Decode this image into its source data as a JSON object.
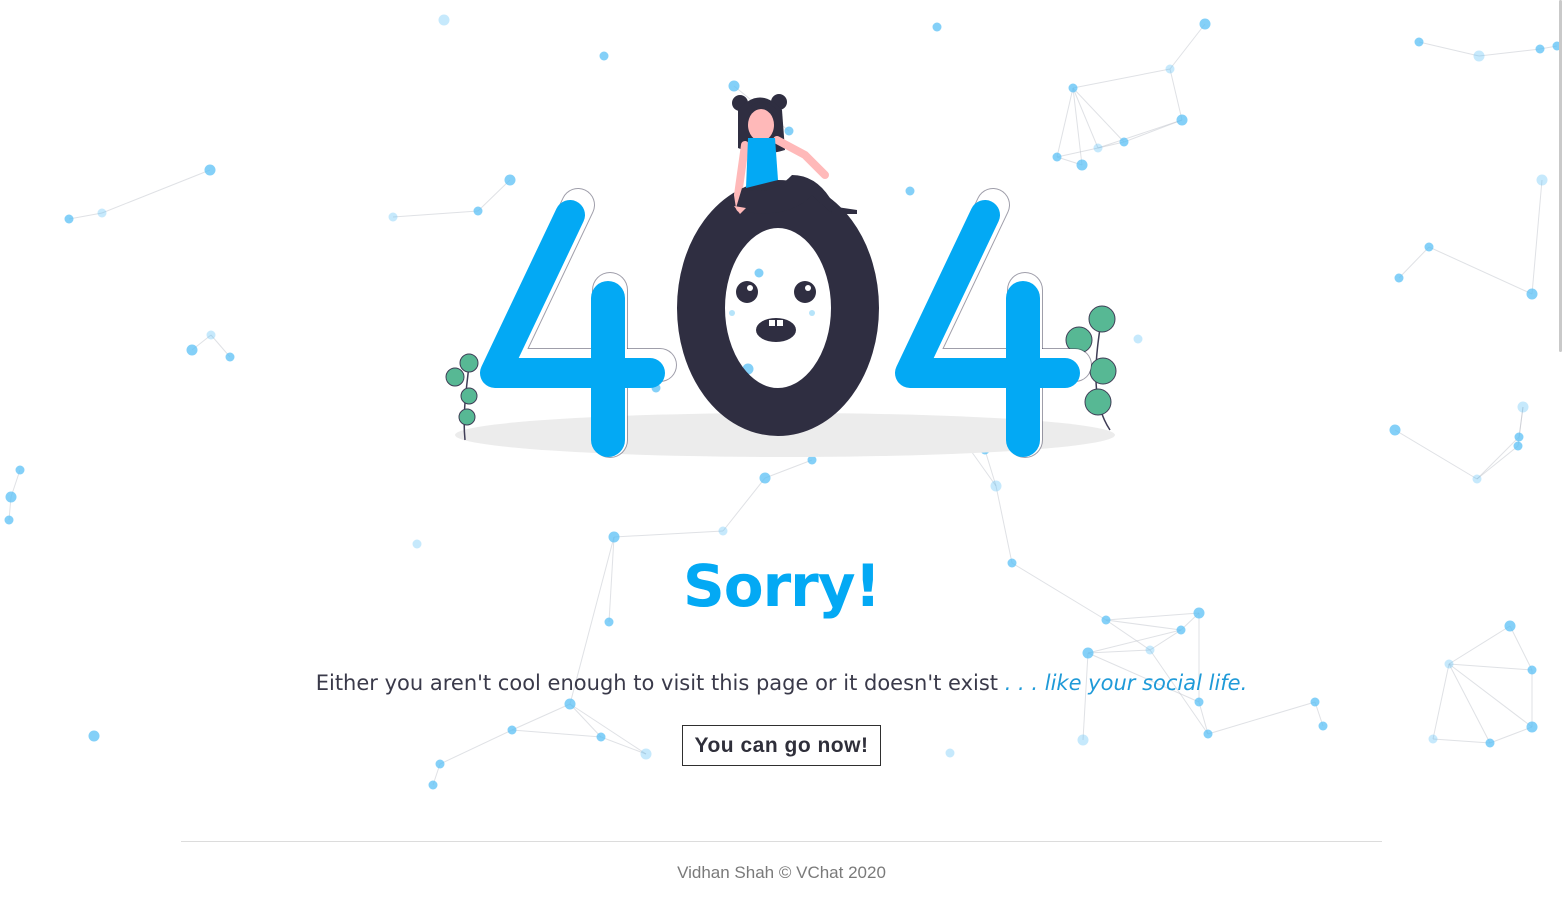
{
  "illustration": {
    "digits": [
      "4",
      "0",
      "4"
    ]
  },
  "heading": "Sorry!",
  "message": {
    "main": "Either you aren't cool enough to visit this page or it doesn't exist",
    "joke": " . . . like your social life."
  },
  "action": {
    "label": "You can go now!"
  },
  "footer": {
    "text": "Vidhan Shah © VChat 2020"
  },
  "colors": {
    "accent": "#03a9f4",
    "dark": "#2f2e41",
    "plant": "#57b894",
    "particle": "#5bc0f5"
  }
}
